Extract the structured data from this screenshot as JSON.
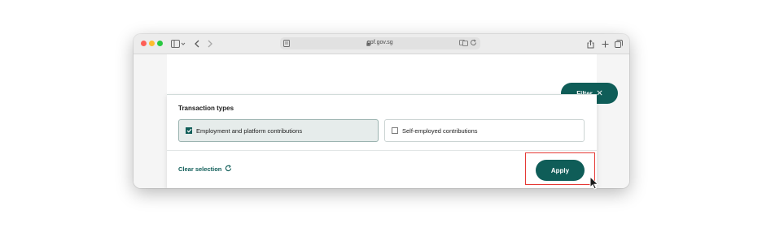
{
  "browser": {
    "url": "cpf.gov.sg"
  },
  "page": {
    "filter_button": {
      "label": "Filter"
    },
    "filter_panel": {
      "section_title": "Transaction types",
      "options": [
        {
          "label": "Employment and platform contributions",
          "checked": true
        },
        {
          "label": "Self-employed contributions",
          "checked": false
        }
      ],
      "clear_label": "Clear selection",
      "apply_label": "Apply"
    }
  },
  "colors": {
    "brand": "#0f5d58",
    "highlight": "#e53935"
  }
}
